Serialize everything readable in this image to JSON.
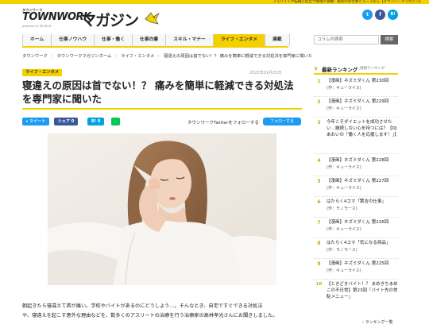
{
  "topbar": {
    "tagline": "アルバイトや転職に役立つ情報が満載！最新のお仕事ニュースなら【タウンワークマガジン】"
  },
  "logo": {
    "small": "タウンワーク",
    "town": "TOWNWORK",
    "mag": "マガジン",
    "powered": "powered by RECRUIT"
  },
  "social": {
    "twitter": "t",
    "facebook": "f",
    "hatena": "B!"
  },
  "nav": {
    "items": [
      "ホーム",
      "仕事ノウハウ",
      "仕事・働く",
      "仕事白書",
      "スキル・マナー",
      "ライフ・エンタメ",
      "連載"
    ]
  },
  "search": {
    "placeholder": "コラム内検索",
    "button": "検索"
  },
  "breadcrumb": {
    "items": [
      "タウンワーク",
      "タウンワークマガジンホーム",
      "ライフ・エンタメ",
      "寝違えの原因は首でない！？ 痛みを簡単に軽減できる対処法を専門家に聞いた"
    ]
  },
  "article": {
    "category": "ライフ・エンタメ",
    "date": "2022年01月25日",
    "title": "寝違えの原因は首でない！？ 痛みを簡単に軽減できる対処法を専門家に聞いた",
    "share": {
      "tweet": "ツイート",
      "facebook": "シェア 0",
      "hatena": "B! 0"
    },
    "follow_text": "タウンワークTwitterをフォローする",
    "follow_button": "フォローする",
    "body_line1": "朝起きたら寝違えて首が痛い。学校やバイトがあるのにどうしよう…。そんなとき、自宅ですぐできる対処法",
    "body_line2": "や、寝違えを起こす意外な理由などを、数多くのアスリートの治療を行う治療家の高林孝光さんにお聞きしました。"
  },
  "ranking": {
    "title": "最新ランキング",
    "sub": "週間ランキング",
    "items": [
      {
        "num": "1",
        "line1": "【漫画】ネズミダくん 第230回",
        "line2": "(作：キューライス)"
      },
      {
        "num": "2",
        "line1": "【漫画】ネズミダくん 第229回",
        "line2": "(作：キューライス)"
      },
      {
        "num": "3",
        "line1": "今年こそダイエットを成功させたい…継続しない心を持つには？【DJあおいの「働く人を応援します！」】",
        "line2": ""
      },
      {
        "num": "4",
        "line1": "【漫画】ネズミダくん 第228回",
        "line2": "(作：キューライス)"
      },
      {
        "num": "5",
        "line1": "【漫画】ネズミダくん 第227回",
        "line2": "(作：キューライス)"
      },
      {
        "num": "6",
        "line1": "はたらく4コマ「驚吉の仕事」",
        "line2": "(作：モノモース)"
      },
      {
        "num": "7",
        "line1": "【漫画】ネズミダくん 第226回",
        "line2": "(作：キューライス)"
      },
      {
        "num": "8",
        "line1": "はたらく4コマ「気になる商品」",
        "line2": "(作：モノモース)"
      },
      {
        "num": "9",
        "line1": "【漫画】ネズミダくん 第225回",
        "line2": "(作：キューライス)"
      },
      {
        "num": "10",
        "line1": "【ときどきバイト！？ まめきちまめこの不日常】第23回「バイト先の常駐メニュー」",
        "line2": ""
      }
    ],
    "more": "ランキング一覧"
  },
  "colors": {
    "accent": "#f5d000",
    "twitter": "#1d9bf0",
    "facebook": "#3b5998",
    "hatena": "#00a4de",
    "line": "#06c755"
  }
}
